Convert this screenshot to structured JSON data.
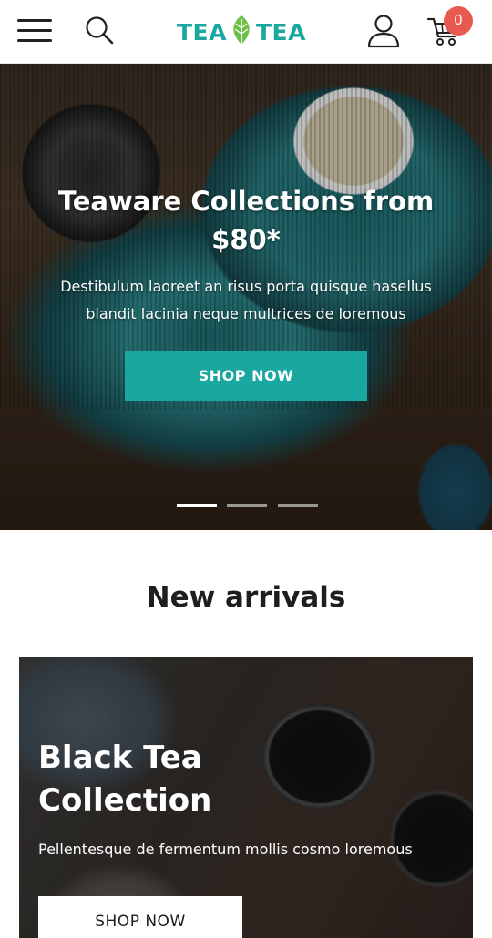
{
  "header": {
    "logo": {
      "left": "TEA",
      "right": "TEA",
      "icon": "leaf-icon"
    },
    "cart_count": "0",
    "icons": [
      "menu-icon",
      "search-icon",
      "user-icon",
      "cart-icon"
    ]
  },
  "hero": {
    "title": "Teaware Collections from $80*",
    "description": "Destibulum laoreet an risus porta quisque hasellus blandit lacinia neque multrices de loremous",
    "button": "SHOP NOW",
    "slides": 3,
    "active_slide": 1
  },
  "new_arrivals": {
    "title": "New arrivals",
    "card": {
      "title": "Black Tea Collection",
      "description": "Pellentesque de fermentum mollis cosmo loremous",
      "button": "SHOP NOW"
    }
  },
  "colors": {
    "accent": "#1aa7a0",
    "badge": "#e85a4f"
  }
}
